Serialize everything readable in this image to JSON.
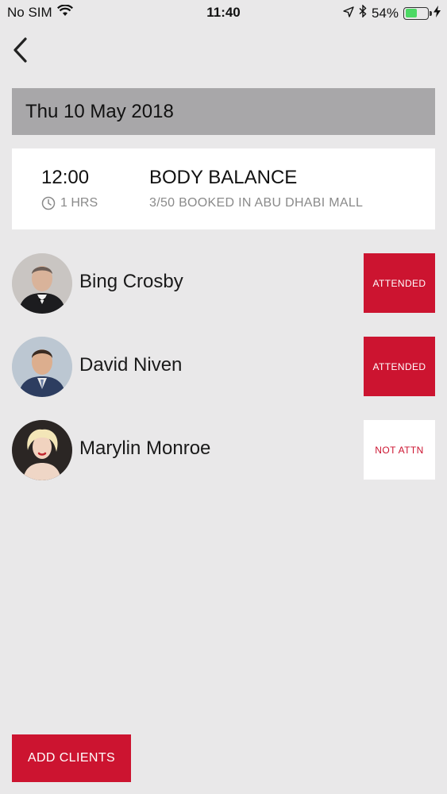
{
  "status_bar": {
    "carrier": "No SIM",
    "time": "11:40",
    "battery_percent": "54%",
    "battery_level": 0.54,
    "battery_color": "#4cd964"
  },
  "nav": {
    "back_icon": "chevron-left-icon"
  },
  "date_header": "Thu 10 May 2018",
  "class": {
    "time": "12:00",
    "duration": "1 HRS",
    "name": "BODY BALANCE",
    "booking": "3/50 BOOKED IN ABU DHABI MALL"
  },
  "clients": [
    {
      "name": "Bing Crosby",
      "status": "ATTENDED"
    },
    {
      "name": "David Niven",
      "status": "ATTENDED"
    },
    {
      "name": "Marylin Monroe",
      "status": "NOT ATTN"
    }
  ],
  "add_clients_label": "ADD CLIENTS",
  "colors": {
    "accent": "#cc1430",
    "background": "#e9e8e9",
    "date_header_bg": "#a8a7a9",
    "card_bg": "#ffffff"
  }
}
